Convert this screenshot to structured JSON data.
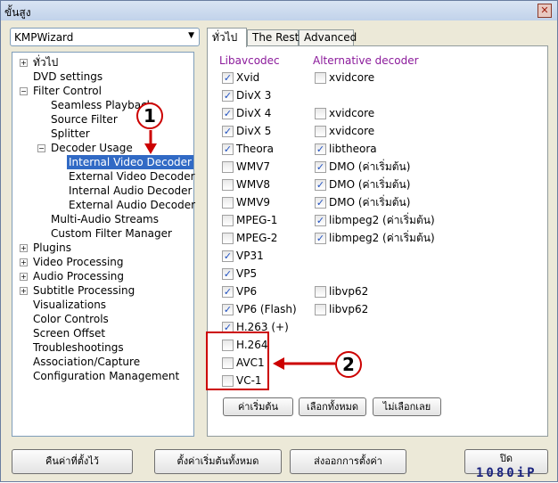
{
  "window": {
    "title": "ขั้นสูง",
    "close_icon": "close-icon"
  },
  "preset": {
    "value": "KMPWizard"
  },
  "tree": [
    {
      "label": "ทั่วไป",
      "level": 0,
      "exp": "+"
    },
    {
      "label": "DVD settings",
      "level": 0
    },
    {
      "label": "Filter Control",
      "level": 0,
      "exp": "-"
    },
    {
      "label": "Seamless Playback",
      "level": 1
    },
    {
      "label": "Source Filter",
      "level": 1
    },
    {
      "label": "Splitter",
      "level": 1
    },
    {
      "label": "Decoder Usage",
      "level": 1,
      "exp": "-"
    },
    {
      "label": "Internal Video Decoder",
      "level": 2,
      "selected": true
    },
    {
      "label": "External Video Decoder",
      "level": 2
    },
    {
      "label": "Internal Audio Decoder",
      "level": 2
    },
    {
      "label": "External Audio Decoder",
      "level": 2
    },
    {
      "label": "Multi-Audio Streams",
      "level": 1
    },
    {
      "label": "Custom Filter Manager",
      "level": 1
    },
    {
      "label": "Plugins",
      "level": 0,
      "exp": "+"
    },
    {
      "label": "Video Processing",
      "level": 0,
      "exp": "+"
    },
    {
      "label": "Audio Processing",
      "level": 0,
      "exp": "+"
    },
    {
      "label": "Subtitle Processing",
      "level": 0,
      "exp": "+"
    },
    {
      "label": "Visualizations",
      "level": 0
    },
    {
      "label": "Color Controls",
      "level": 0
    },
    {
      "label": "Screen Offset",
      "level": 0
    },
    {
      "label": "Troubleshootings",
      "level": 0
    },
    {
      "label": "Association/Capture",
      "level": 0
    },
    {
      "label": "Configuration Management",
      "level": 0
    }
  ],
  "tabs": [
    {
      "label": "ทั่วไป",
      "active": true
    },
    {
      "label": "The Rest"
    },
    {
      "label": "Advanced"
    }
  ],
  "headers": {
    "libavcodec": "Libavcodec",
    "alternative": "Alternative decoder"
  },
  "codecs": [
    {
      "label": "Xvid",
      "checked": true,
      "alt": {
        "label": "xvidcore",
        "checked": false
      }
    },
    {
      "label": "DivX 3",
      "checked": true
    },
    {
      "label": "DivX 4",
      "checked": true,
      "alt": {
        "label": "xvidcore",
        "checked": false
      }
    },
    {
      "label": "DivX 5",
      "checked": true,
      "alt": {
        "label": "xvidcore",
        "checked": false
      }
    },
    {
      "label": "Theora",
      "checked": true,
      "alt": {
        "label": "libtheora",
        "checked": true
      }
    },
    {
      "label": "WMV7",
      "checked": false,
      "alt": {
        "label": "DMO (ค่าเริ่มต้น)",
        "checked": true
      }
    },
    {
      "label": "WMV8",
      "checked": false,
      "alt": {
        "label": "DMO (ค่าเริ่มต้น)",
        "checked": true
      }
    },
    {
      "label": "WMV9",
      "checked": false,
      "alt": {
        "label": "DMO (ค่าเริ่มต้น)",
        "checked": true
      }
    },
    {
      "label": "MPEG-1",
      "checked": false,
      "alt": {
        "label": "libmpeg2 (ค่าเริ่มต้น)",
        "checked": true
      }
    },
    {
      "label": "MPEG-2",
      "checked": false,
      "alt": {
        "label": "libmpeg2 (ค่าเริ่มต้น)",
        "checked": true
      }
    },
    {
      "label": "VP31",
      "checked": true
    },
    {
      "label": "VP5",
      "checked": true
    },
    {
      "label": "VP6",
      "checked": true,
      "alt": {
        "label": "libvp62",
        "checked": false
      }
    },
    {
      "label": "VP6 (Flash)",
      "checked": true,
      "alt": {
        "label": "libvp62",
        "checked": false
      }
    },
    {
      "label": "H.263 (+)",
      "checked": true
    },
    {
      "label": "H.264",
      "checked": false
    },
    {
      "label": "AVC1",
      "checked": false
    },
    {
      "label": "VC-1",
      "checked": false
    }
  ],
  "page_buttons": {
    "default": "ค่าเริ่มต้น",
    "select_all": "เลือกทั้งหมด",
    "select_none": "ไม่เลือกเลย"
  },
  "footer": {
    "restore": "คืนค่าที่ตั้งไว้",
    "reset_all": "ตั้งค่าเริ่มต้นทั้งหมด",
    "export": "ส่งออกการตั้งค่า",
    "close": "ปิด"
  },
  "annotations": {
    "one": "1",
    "two": "2",
    "color": "#cc0000"
  },
  "watermark": "1080iP"
}
